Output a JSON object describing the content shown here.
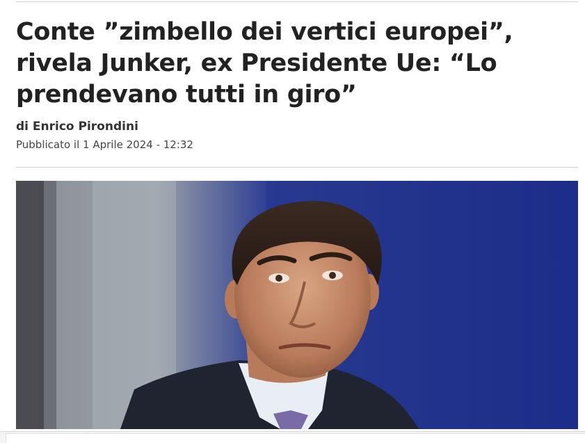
{
  "article": {
    "title": "Conte ”zimbello dei vertici europei”, rivela Junker, ex Presidente Ue: “Lo prendevano tutti in giro”",
    "byline": "di Enrico Pirondini",
    "published": "Pubblicato il 1 Aprile 2024 - 12:32"
  },
  "colors": {
    "text": "#222222",
    "rule": "#cfcfcf",
    "photo_background": "#1d2f86"
  }
}
